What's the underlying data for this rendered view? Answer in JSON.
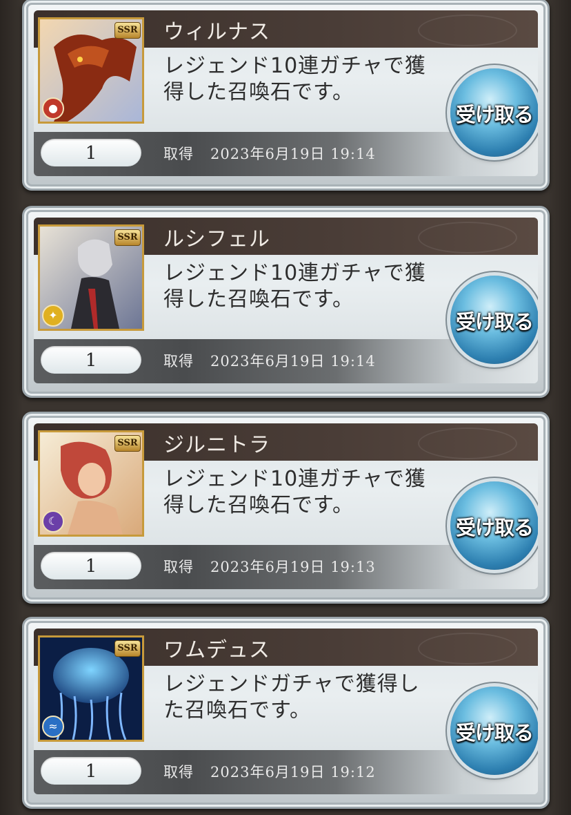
{
  "items": [
    {
      "name": "ウィルナス",
      "description_line1": "レジェンド10連ガチャで獲",
      "description_line2": "得した召喚石です。",
      "quantity": "1",
      "acquired_label": "取得",
      "acquired_date": "2023年6月19日 19:14",
      "receive_label": "受け取る",
      "rarity": "SSR",
      "element": "fire",
      "element_color": "#c0392b"
    },
    {
      "name": "ルシフェル",
      "description_line1": "レジェンド10連ガチャで獲",
      "description_line2": "得した召喚石です。",
      "quantity": "1",
      "acquired_label": "取得",
      "acquired_date": "2023年6月19日 19:14",
      "receive_label": "受け取る",
      "rarity": "SSR",
      "element": "light",
      "element_color": "#e0b020"
    },
    {
      "name": "ジルニトラ",
      "description_line1": "レジェンド10連ガチャで獲",
      "description_line2": "得した召喚石です。",
      "quantity": "1",
      "acquired_label": "取得",
      "acquired_date": "2023年6月19日 19:13",
      "receive_label": "受け取る",
      "rarity": "SSR",
      "element": "dark",
      "element_color": "#6b3fa8"
    },
    {
      "name": "ワムデュス",
      "description_line1": "レジェンドガチャで獲得し",
      "description_line2": "た召喚石です。",
      "quantity": "1",
      "acquired_label": "取得",
      "acquired_date": "2023年6月19日 19:12",
      "receive_label": "受け取る",
      "rarity": "SSR",
      "element": "water",
      "element_color": "#2a6fc4"
    }
  ]
}
